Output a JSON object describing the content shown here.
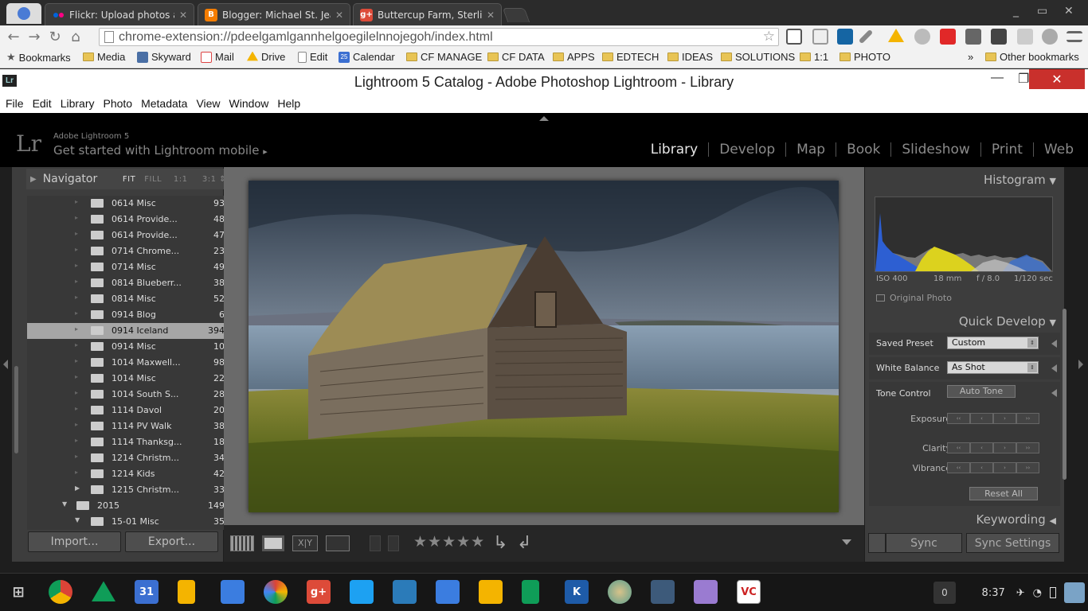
{
  "browser": {
    "tabs": [
      {
        "title": "Flickr: Upload photos anc",
        "icon": "flickr-icon"
      },
      {
        "title": "Blogger: Michael St. Jean",
        "icon": "blogger-icon"
      },
      {
        "title": "Buttercup Farm, Sterling",
        "icon": "google-plus-icon"
      }
    ],
    "url": "chrome-extension://pdeelgamlgannhelgoegilelnnojegoh/index.html",
    "bookmarks": [
      {
        "label": "Bookmarks"
      },
      {
        "label": "Media"
      },
      {
        "label": "Skyward"
      },
      {
        "label": "Mail"
      },
      {
        "label": "Drive"
      },
      {
        "label": "Edit"
      },
      {
        "label": "Calendar"
      },
      {
        "label": "CF MANAGE"
      },
      {
        "label": "CF DATA"
      },
      {
        "label": "APPS"
      },
      {
        "label": "EDTECH"
      },
      {
        "label": "IDEAS"
      },
      {
        "label": "SOLUTIONS"
      },
      {
        "label": "1:1"
      },
      {
        "label": "PHOTO"
      }
    ],
    "overflow": "»",
    "other_bookmarks": "Other bookmarks",
    "calendar_day": "25"
  },
  "window": {
    "title": "Lightroom 5 Catalog - Adobe Photoshop Lightroom - Library",
    "logo": "Lr"
  },
  "menu": [
    "File",
    "Edit",
    "Library",
    "Photo",
    "Metadata",
    "View",
    "Window",
    "Help"
  ],
  "identity": {
    "logo": "Lr",
    "product": "Adobe Lightroom 5",
    "mobile": "Get started with Lightroom mobile",
    "mobile_arrow": "▸"
  },
  "modules": [
    "Library",
    "Develop",
    "Map",
    "Book",
    "Slideshow",
    "Print",
    "Web"
  ],
  "active_module": "Library",
  "navigator": {
    "title": "Navigator",
    "options": [
      "FIT",
      "FILL",
      "1:1",
      "3:1"
    ]
  },
  "folders": [
    {
      "name": "0614 Misc",
      "count": "93"
    },
    {
      "name": "0614 Provide...",
      "count": "48"
    },
    {
      "name": "0614 Provide...",
      "count": "47"
    },
    {
      "name": "0714 Chrome...",
      "count": "23"
    },
    {
      "name": "0714 Misc",
      "count": "49"
    },
    {
      "name": "0814 Blueberr...",
      "count": "38"
    },
    {
      "name": "0814 Misc",
      "count": "52"
    },
    {
      "name": "0914 Blog",
      "count": "6"
    },
    {
      "name": "0914 Iceland",
      "count": "394",
      "selected": true
    },
    {
      "name": "0914 Misc",
      "count": "10"
    },
    {
      "name": "1014 Maxwell...",
      "count": "98"
    },
    {
      "name": "1014 Misc",
      "count": "22"
    },
    {
      "name": "1014 South S...",
      "count": "28"
    },
    {
      "name": "1114 Davol",
      "count": "20"
    },
    {
      "name": "1114 PV Walk",
      "count": "38"
    },
    {
      "name": "1114 Thanksg...",
      "count": "18"
    },
    {
      "name": "1214 Christm...",
      "count": "34"
    },
    {
      "name": "1214 Kids",
      "count": "42"
    },
    {
      "name": "1215 Christm...",
      "count": "33"
    },
    {
      "name": "2015",
      "count": "149"
    },
    {
      "name": "15-01 Misc",
      "count": "35"
    }
  ],
  "left_buttons": {
    "import": "Import...",
    "export": "Export..."
  },
  "histogram": {
    "title": "Histogram",
    "iso": "ISO 400",
    "focal": "18 mm",
    "aperture": "f / 8.0",
    "shutter": "1/120 sec",
    "original_photo": "Original Photo"
  },
  "quick_develop": {
    "title": "Quick Develop",
    "saved_preset_label": "Saved Preset",
    "saved_preset_value": "Custom",
    "white_balance_label": "White Balance",
    "white_balance_value": "As Shot",
    "tone_control_label": "Tone Control",
    "auto_tone": "Auto Tone",
    "exposure": "Exposure",
    "clarity": "Clarity",
    "vibrance": "Vibrance",
    "reset_all": "Reset All"
  },
  "keywording": "Keywording",
  "sync": {
    "sync": "Sync",
    "sync_settings": "Sync Settings"
  },
  "toolbar": {
    "stars": "★★★★★"
  },
  "shelf": {
    "notifications": "0",
    "time": "8:37"
  }
}
